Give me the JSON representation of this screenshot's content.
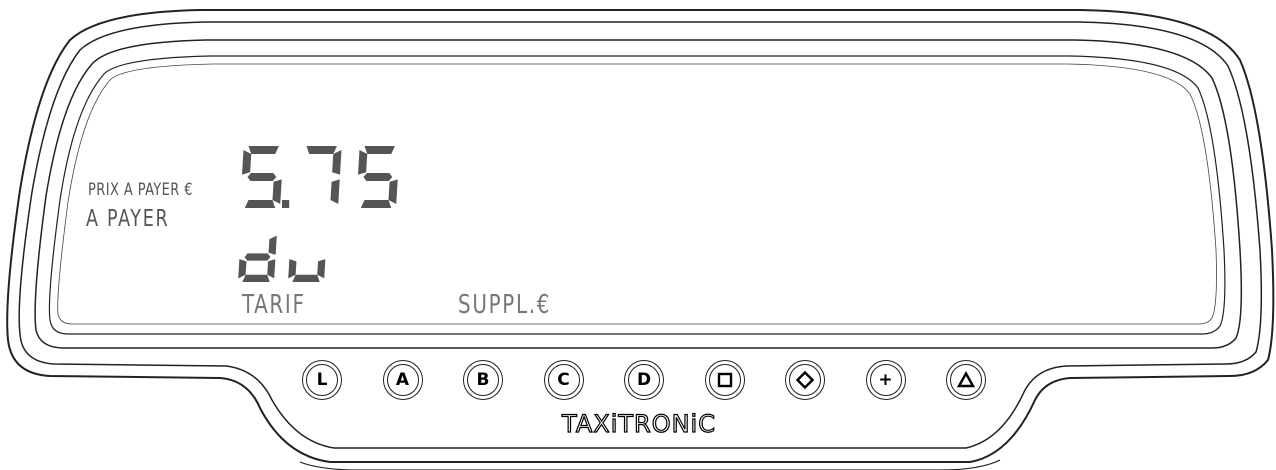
{
  "display": {
    "prix_label": "PRIX A PAYER €",
    "apayer_label": "A PAYER",
    "amount": "5.75",
    "status": "du",
    "tarif_label": "TARIF",
    "suppl_label": "SUPPL.€"
  },
  "buttons": [
    {
      "label": "L",
      "icon": "letter-L"
    },
    {
      "label": "A",
      "icon": "letter-A"
    },
    {
      "label": "B",
      "icon": "letter-B"
    },
    {
      "label": "C",
      "icon": "letter-C"
    },
    {
      "label": "D",
      "icon": "letter-D"
    },
    {
      "label": "",
      "icon": "square-icon"
    },
    {
      "label": "",
      "icon": "diamond-icon"
    },
    {
      "label": "+",
      "icon": "plus-icon"
    },
    {
      "label": "",
      "icon": "triangle-icon"
    }
  ],
  "brand": "TAXiTRONiC",
  "colors": {
    "outline": "#222222",
    "lcd_text": "#555555",
    "background": "#ffffff"
  }
}
